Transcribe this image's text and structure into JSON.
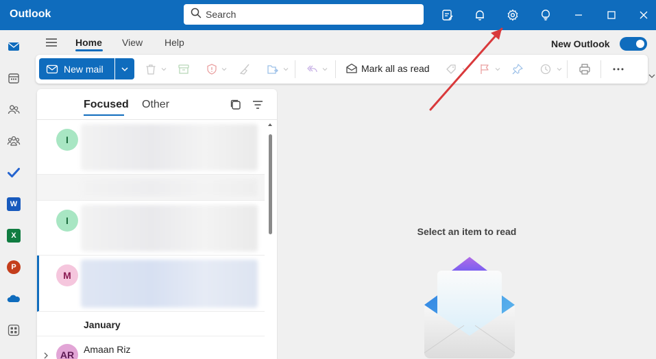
{
  "titlebar": {
    "app_name": "Outlook",
    "search_placeholder": "Search",
    "icons": [
      "compose-note-icon",
      "bell-icon",
      "gear-icon",
      "lightbulb-icon",
      "minimize-icon",
      "maximize-icon",
      "close-icon"
    ]
  },
  "rail": {
    "items": [
      "mail-icon",
      "calendar-icon",
      "people-icon",
      "groups-icon",
      "todo-icon",
      "word-icon",
      "excel-icon",
      "powerpoint-icon",
      "onedrive-icon",
      "more-apps-icon"
    ],
    "word_letter": "W",
    "excel_letter": "X",
    "powerpoint_letter": "P"
  },
  "ribbon": {
    "tabs": [
      {
        "label": "Home",
        "active": true
      },
      {
        "label": "View",
        "active": false
      },
      {
        "label": "Help",
        "active": false
      }
    ],
    "new_outlook_label": "New Outlook",
    "new_outlook_on": true
  },
  "toolbar": {
    "new_mail_label": "New mail",
    "mark_all_read_label": "Mark all as read",
    "icons": [
      "delete-icon",
      "archive-icon",
      "report-icon",
      "sweep-icon",
      "move-to-icon",
      "reply-all-icon",
      "tag-icon",
      "flag-icon",
      "pin-icon",
      "snooze-icon",
      "print-icon",
      "more-icon"
    ]
  },
  "mail_list": {
    "pivots": [
      {
        "label": "Focused",
        "active": true
      },
      {
        "label": "Other",
        "active": false
      }
    ],
    "items": [
      {
        "avatar_initial": "I",
        "avatar_bg": "#a8e6c3",
        "avatar_fg": "#1a6b3c"
      },
      {
        "avatar_initial": "I",
        "avatar_bg": "#a8e6c3",
        "avatar_fg": "#1a6b3c"
      },
      {
        "avatar_initial": "M",
        "avatar_bg": "#f5c6dd",
        "avatar_fg": "#8a1a52",
        "selected": true
      }
    ],
    "section_label": "January",
    "last_item": {
      "avatar_initial": "AR",
      "avatar_bg": "#e2a5d6",
      "avatar_fg": "#5c1a52",
      "sender": "Amaan Riz"
    }
  },
  "reading_pane": {
    "empty_message": "Select an item to read"
  },
  "colors": {
    "brand": "#0f6cbd",
    "annotation_arrow": "#d9393b"
  }
}
